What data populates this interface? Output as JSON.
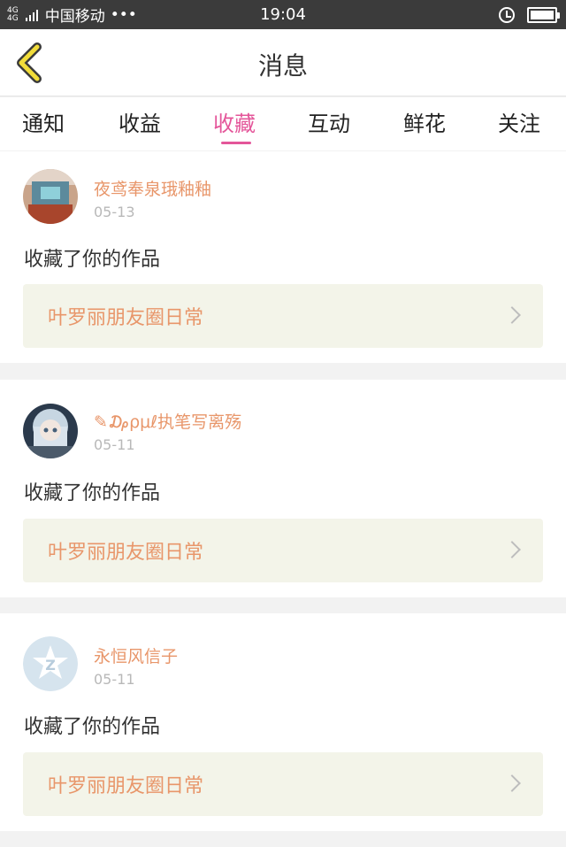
{
  "status_bar": {
    "net_top": "4G",
    "net_bottom": "4G",
    "carrier": "中国移动",
    "dots": "•••",
    "time": "19:04",
    "alarm_icon": "alarm-clock-icon",
    "battery_icon": "battery-full-icon"
  },
  "header": {
    "back_icon": "chevron-left-icon",
    "title": "消息"
  },
  "tabs": {
    "items": [
      {
        "label": "通知"
      },
      {
        "label": "收益"
      },
      {
        "label": "收藏"
      },
      {
        "label": "互动"
      },
      {
        "label": "鲜花"
      },
      {
        "label": "关注"
      }
    ],
    "active_index": 2
  },
  "colors": {
    "accent_pink": "#e4569a",
    "username_orange": "#e8966a",
    "card_link_bg": "#f3f4e9"
  },
  "messages": [
    {
      "username": "夜鸢奉泉珴釉釉",
      "date": "05-13",
      "action": "收藏了你的作品",
      "work_title": "叶罗丽朋友圈日常",
      "avatar_icon": "user-avatar"
    },
    {
      "username": "✎₯ρμℓ执笔写离殇",
      "date": "05-11",
      "action": "收藏了你的作品",
      "work_title": "叶罗丽朋友圈日常",
      "avatar_icon": "user-avatar"
    },
    {
      "username": "永恒风信子",
      "date": "05-11",
      "action": "收藏了你的作品",
      "work_title": "叶罗丽朋友圈日常",
      "avatar_icon": "default-avatar-icon"
    }
  ]
}
